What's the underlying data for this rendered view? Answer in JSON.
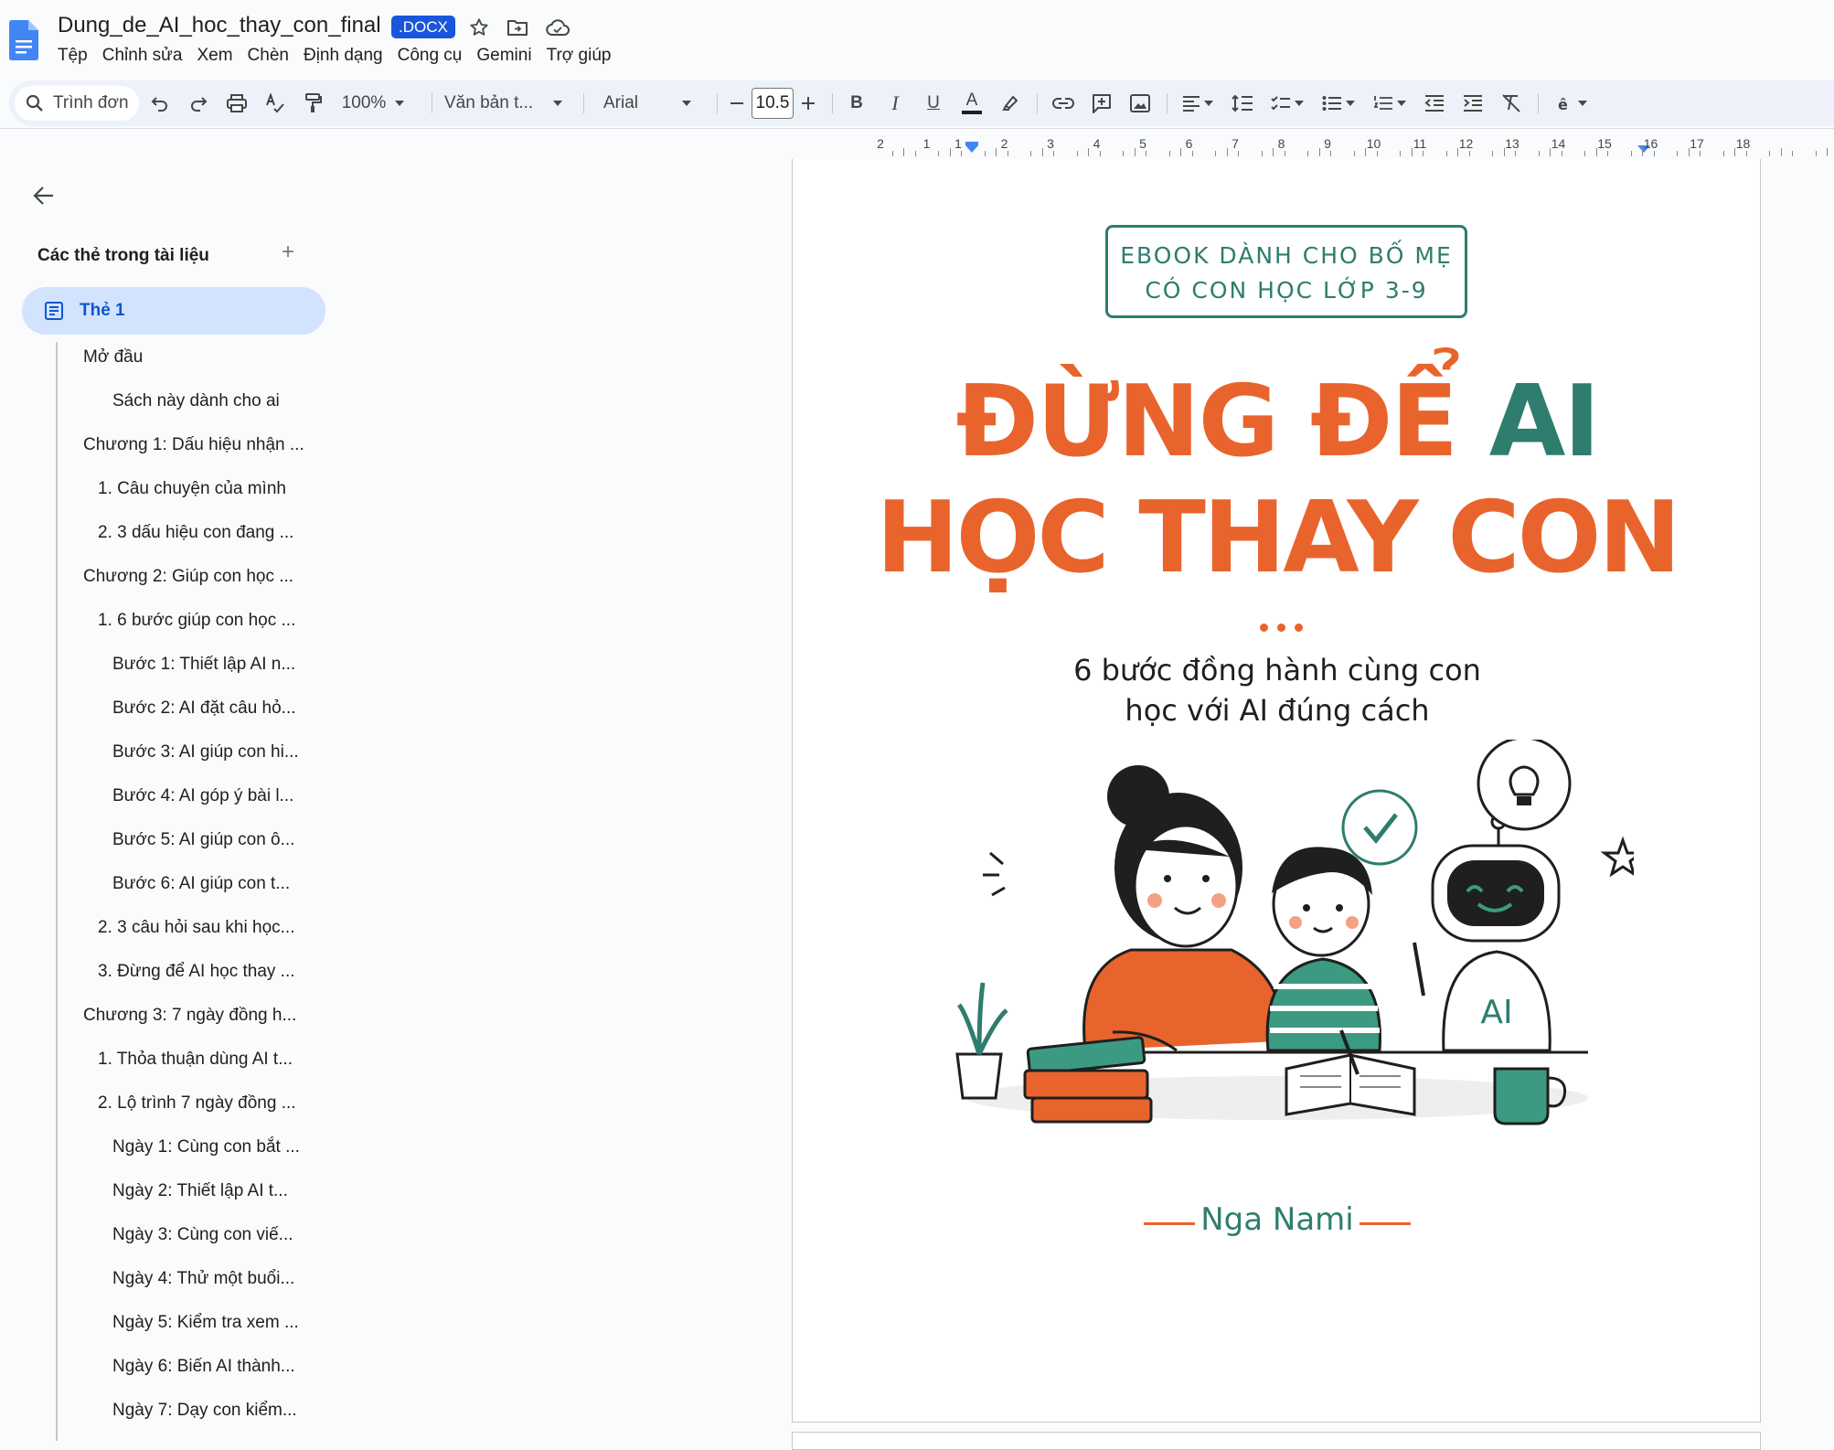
{
  "titlebar": {
    "doc_title": "Dung_de_AI_hoc_thay_con_final",
    "badge": ".DOCX",
    "icons": [
      "star-icon",
      "move-folder-icon",
      "cloud-status-icon"
    ]
  },
  "menu": [
    "Tệp",
    "Chỉnh sửa",
    "Xem",
    "Chèn",
    "Định dạng",
    "Công cụ",
    "Gemini",
    "Trợ giúp"
  ],
  "toolbar": {
    "search_label": "Trình đơn",
    "zoom": "100%",
    "style": "Văn bản t...",
    "font": "Arial",
    "font_size": "10.5",
    "bold": "B",
    "italic": "I",
    "underline": "U",
    "text_color": "A"
  },
  "ruler": {
    "left_labels": [
      "2",
      "1"
    ],
    "labels": [
      "1",
      "2",
      "3",
      "4",
      "5",
      "6",
      "7",
      "8",
      "9",
      "10",
      "11",
      "12",
      "13",
      "14",
      "15",
      "16",
      "17",
      "18"
    ]
  },
  "outline": {
    "header": "Các thẻ trong tài liệu",
    "tab_label": "Thẻ 1",
    "items": [
      {
        "text": "Mở đầu",
        "level": 1
      },
      {
        "text": "Sách này dành cho ai",
        "level": 3
      },
      {
        "text": "Chương 1: Dấu hiệu nhận ...",
        "level": 1
      },
      {
        "text": "1. Câu chuyện của mình",
        "level": 2
      },
      {
        "text": "2. 3 dấu hiệu con đang ...",
        "level": 2
      },
      {
        "text": "Chương 2: Giúp con học ...",
        "level": 1
      },
      {
        "text": "1. 6 bước giúp con học ...",
        "level": 2
      },
      {
        "text": "Bước 1: Thiết lập AI n...",
        "level": 3
      },
      {
        "text": "Bước 2: AI đặt câu hỏ...",
        "level": 3
      },
      {
        "text": "Bước 3: AI giúp con hi...",
        "level": 3
      },
      {
        "text": "Bước 4: AI góp ý bài l...",
        "level": 3
      },
      {
        "text": "Bước 5: AI giúp con ô...",
        "level": 3
      },
      {
        "text": "Bước 6: AI giúp con t...",
        "level": 3
      },
      {
        "text": "2. 3 câu hỏi sau khi học...",
        "level": 2
      },
      {
        "text": "3. Đừng để AI học thay ...",
        "level": 2
      },
      {
        "text": "Chương 3: 7 ngày đồng h...",
        "level": 1
      },
      {
        "text": "1. Thỏa thuận dùng AI t...",
        "level": 2
      },
      {
        "text": "2. Lộ trình 7 ngày đồng ...",
        "level": 2
      },
      {
        "text": "Ngày 1: Cùng con bắt ...",
        "level": 3
      },
      {
        "text": "Ngày 2: Thiết lập AI t...",
        "level": 3
      },
      {
        "text": "Ngày 3: Cùng con viế...",
        "level": 3
      },
      {
        "text": "Ngày 4: Thử một buổi...",
        "level": 3
      },
      {
        "text": "Ngày 5: Kiểm tra xem ...",
        "level": 3
      },
      {
        "text": "Ngày 6: Biến AI thành...",
        "level": 3
      },
      {
        "text": "Ngày 7: Dạy con kiểm...",
        "level": 3
      }
    ]
  },
  "cover": {
    "ebook_line1": "EBOOK DÀNH CHO BỐ MẸ",
    "ebook_line2": "CÓ CON HỌC LỚP 3-9",
    "title_part1": "ĐỪNG ĐỂ ",
    "title_ai": "AI",
    "title_line2": "HỌC THAY CON",
    "subtitle_line1": "6 bước đồng hành cùng con",
    "subtitle_line2": "học với AI đúng cách",
    "robot_label": "AI",
    "author": "Nga Nami",
    "colors": {
      "orange": "#e8642c",
      "teal": "#2e7d6e"
    }
  }
}
